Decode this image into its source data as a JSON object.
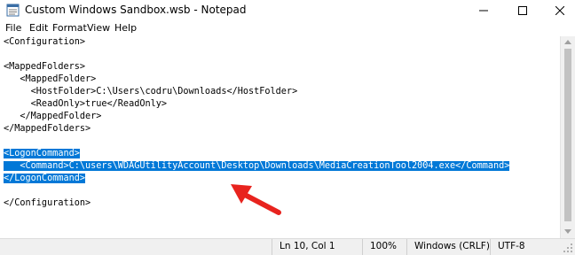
{
  "window": {
    "title": "Custom Windows Sandbox.wsb - Notepad",
    "minimize_icon": "minimize-icon",
    "maximize_icon": "maximize-icon",
    "close_icon": "close-icon"
  },
  "menu": {
    "file": "File",
    "edit": "Edit",
    "format": "Format",
    "view": "View",
    "help": "Help"
  },
  "editor": {
    "lines": [
      "<Configuration>",
      "",
      "<MappedFolders>",
      "   <MappedFolder>",
      "     <HostFolder>C:\\Users\\codru\\Downloads</HostFolder>",
      "     <ReadOnly>true</ReadOnly>",
      "   </MappedFolder>",
      "</MappedFolders>",
      "",
      "<LogonCommand>",
      "   <Command>C:\\users\\WDAGUtilityAccount\\Desktop\\Downloads\\MediaCreationTool2004.exe</Command>",
      "</LogonCommand>",
      "",
      "</Configuration>"
    ],
    "selection_color": "#0078d7"
  },
  "status": {
    "position": "Ln 10, Col 1",
    "zoom": "100%",
    "line_ending": "Windows (CRLF)",
    "encoding": "UTF-8"
  },
  "annotation": {
    "arrow_color": "#e8231e"
  }
}
